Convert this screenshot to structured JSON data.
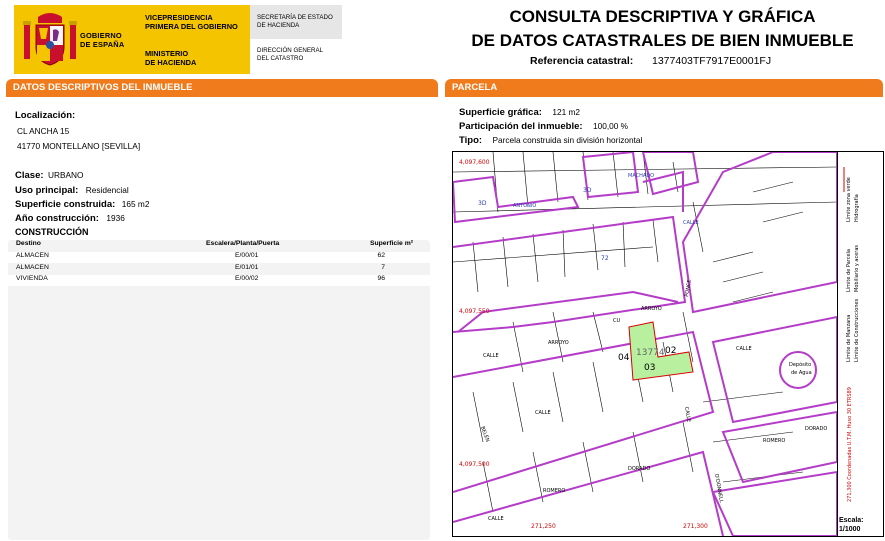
{
  "header": {
    "gobierno": [
      "GOBIERNO",
      "DE ESPAÑA"
    ],
    "vicepresidencia": [
      "VICEPRESIDENCIA",
      "PRIMERA DEL GOBIERNO"
    ],
    "ministerio": [
      "MINISTERIO",
      "DE HACIENDA"
    ],
    "secretaria": [
      "SECRETARÍA DE ESTADO",
      "DE HACIENDA"
    ],
    "direccion": [
      "DIRECCIÓN GENERAL",
      "DEL CATASTRO"
    ],
    "title_line1": "CONSULTA DESCRIPTIVA Y GRÁFICA",
    "title_line2": "DE DATOS CATASTRALES DE BIEN INMUEBLE",
    "ref_label": "Referencia catastral:",
    "ref_value": "1377403TF7917E0001FJ"
  },
  "colors": {
    "accent": "#f07b1c",
    "logo_yellow": "#f5c400",
    "parcel_outline": "#b43cc8",
    "highlight": "#b8f0a0"
  },
  "left": {
    "section_title": "DATOS DESCRIPTIVOS DEL INMUEBLE",
    "localizacion_label": "Localización:",
    "address_line1": "CL ANCHA 15",
    "address_line2": "41770 MONTELLANO [SEVILLA]",
    "clase_label": "Clase:",
    "clase_value": "URBANO",
    "uso_label": "Uso principal:",
    "uso_value": "Residencial",
    "sup_label": "Superficie construida:",
    "sup_value": "165 m2",
    "anio_label": "Año construcción:",
    "anio_value": "1936",
    "construccion_title": "CONSTRUCCIÓN",
    "table": {
      "headers": [
        "Destino",
        "Escalera/Planta/Puerta",
        "Superficie m²"
      ],
      "rows": [
        [
          "ALMACEN",
          "E/00/01",
          "62"
        ],
        [
          "ALMACEN",
          "E/01/01",
          "7"
        ],
        [
          "VIVIENDA",
          "E/00/02",
          "96"
        ]
      ]
    }
  },
  "right": {
    "section_title": "PARCELA",
    "sup_grafica_label": "Superficie gráfica:",
    "sup_grafica_value": "121 m2",
    "participacion_label": "Participación del inmueble:",
    "participacion_value": "100,00 %",
    "tipo_label": "Tipo:",
    "tipo_value": "Parcela construida sin división horizontal",
    "map": {
      "coord_labels_y": [
        "4,097,600",
        "4,097,550",
        "4,097,500"
      ],
      "coord_labels_x": [
        "271,250",
        "271,300"
      ],
      "parcel_numbers": [
        "02",
        "03",
        "04"
      ],
      "parcel_id_fragment": "13774",
      "streets": [
        "ANTONIO",
        "MACHADO",
        "CALLE",
        "ARROYO",
        "ARROYO",
        "CALLE",
        "CALLE",
        "BELÉN",
        "DORADO",
        "ROMERO",
        "CALLE",
        "ROMERO",
        "DORADO",
        "PONCE",
        "ARROYO",
        "CALLE",
        "Depósito de Agua",
        "CALLE",
        "CU",
        "CALLE",
        "O'DONNELL"
      ],
      "house_numbers": [
        "3D",
        "3D",
        "3D",
        "22",
        "20",
        "18",
        "16",
        "14",
        "12",
        "10",
        "8",
        "6",
        "4",
        "2",
        "72",
        "6",
        "4",
        "2",
        "8",
        "6",
        "13",
        "15",
        "17",
        "19",
        "21",
        "23",
        "25",
        "27",
        "29",
        "11",
        "9",
        "7",
        "5",
        "3",
        "1",
        "15B",
        "13",
        "11",
        "9",
        "7",
        "5",
        "3",
        "1",
        "2",
        "4",
        "6",
        "8",
        "10",
        "12",
        "14",
        "16",
        "18",
        "20",
        "22",
        "24",
        "26",
        "28",
        "30",
        "32",
        "34"
      ],
      "legend": [
        "Límite de Manzana",
        "Límite de Parcela",
        "Límite de Construcciones",
        "Mobiliario y aceras",
        "Límite zona verde",
        "Hidrografía"
      ],
      "coord_note": "271,300 Coordenadas U.T.M. Huso 30 ETRS89",
      "scale_label": "Escala:",
      "scale_value": "1/1000"
    }
  }
}
